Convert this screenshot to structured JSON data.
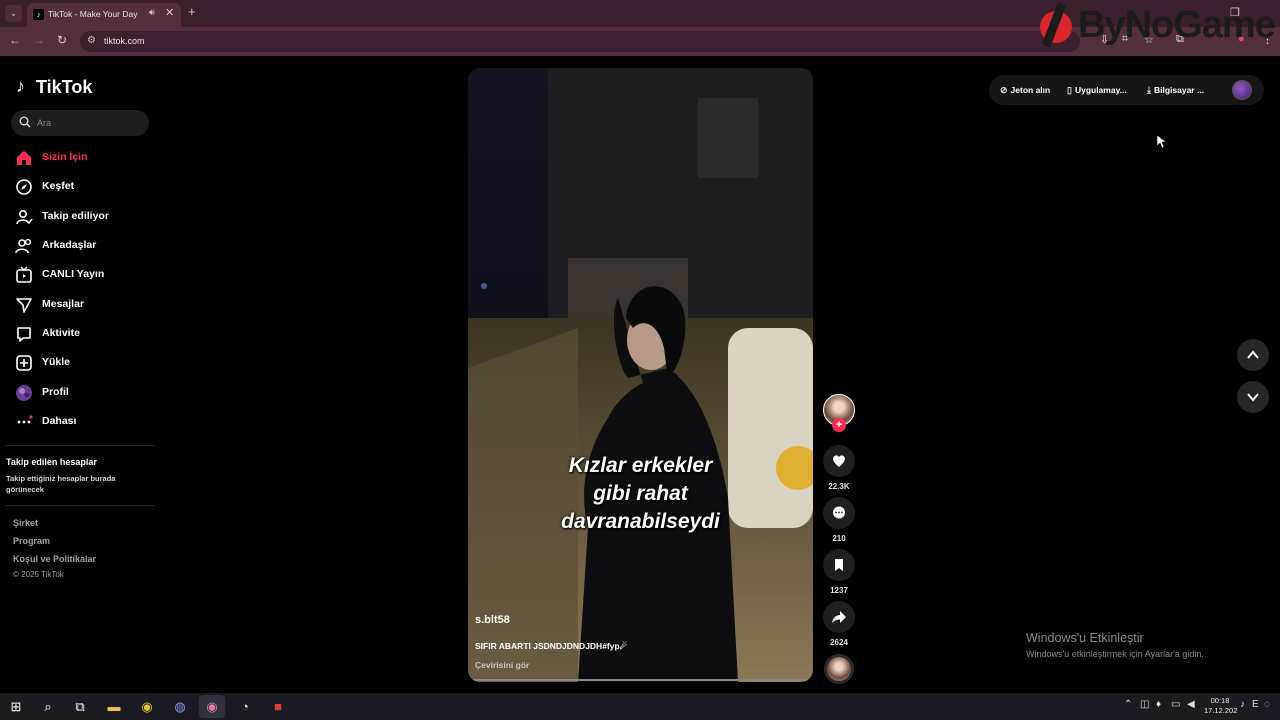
{
  "browser": {
    "tab_title": "TikTok - Make Your Day",
    "url": "tiktok.com",
    "watermark_logo": "ByNoGame"
  },
  "sidebar": {
    "logo": "TikTok",
    "search_placeholder": "Ara",
    "items": [
      {
        "label": "Sizin İçin",
        "icon": "home-icon"
      },
      {
        "label": "Keşfet",
        "icon": "compass-icon"
      },
      {
        "label": "Takip ediliyor",
        "icon": "following-icon"
      },
      {
        "label": "Arkadaşlar",
        "icon": "friends-icon"
      },
      {
        "label": "CANLI Yayın",
        "icon": "live-icon"
      },
      {
        "label": "Mesajlar",
        "icon": "messages-icon"
      },
      {
        "label": "Aktivite",
        "icon": "activity-icon"
      },
      {
        "label": "Yükle",
        "icon": "upload-icon"
      },
      {
        "label": "Profil",
        "icon": "avatar"
      },
      {
        "label": "Dahası",
        "icon": "more-icon"
      }
    ],
    "followed_title": "Takip edilen hesaplar",
    "followed_desc": "Takip ettiğiniz hesaplar burada görünecek",
    "footer_links": [
      "Şirket",
      "Program",
      "Koşul ve Politikalar"
    ],
    "copyright": "© 2025 TikTok"
  },
  "top_actions": {
    "coins": "Jeton alın",
    "app": "Uygulamay...",
    "computer": "Bilgisayar ..."
  },
  "video": {
    "caption_lines": [
      "Kızlar erkekler",
      "gibi rahat",
      "davranabilseydi"
    ],
    "username": "s.blt58",
    "description": "SIFIR ABARTI JSDNDJDNDJDH#fyp☄",
    "translate": "Çevirisini gör",
    "likes": "22.3K",
    "comments": "210",
    "saves": "1237",
    "shares": "2624"
  },
  "activation": {
    "title": "Windows'u Etkinleştir",
    "subtitle": "Windows'u etkinleştirmek için Ayarlar'a gidin."
  },
  "taskbar": {
    "time": "00:18",
    "date": "17.12.202"
  }
}
